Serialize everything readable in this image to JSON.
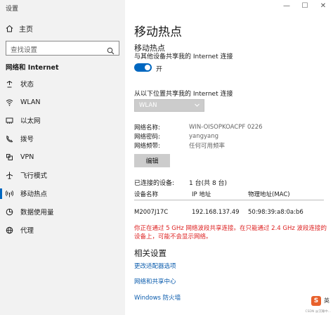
{
  "window": {
    "title": "设置",
    "controls": [
      "—",
      "☐",
      "✕"
    ]
  },
  "sidebar": {
    "home_label": "主页",
    "search_placeholder": "查找设置",
    "section_title": "网络和 Internet",
    "items": [
      {
        "label": "状态",
        "icon": "status-icon"
      },
      {
        "label": "WLAN",
        "icon": "wifi-icon"
      },
      {
        "label": "以太网",
        "icon": "ethernet-icon"
      },
      {
        "label": "拨号",
        "icon": "dialup-icon"
      },
      {
        "label": "VPN",
        "icon": "vpn-icon"
      },
      {
        "label": "飞行模式",
        "icon": "airplane-icon"
      },
      {
        "label": "移动热点",
        "icon": "hotspot-icon",
        "active": true
      },
      {
        "label": "数据使用量",
        "icon": "data-usage-icon"
      },
      {
        "label": "代理",
        "icon": "globe-icon"
      }
    ]
  },
  "main": {
    "title": "移动热点",
    "hotspot": {
      "title": "移动热点",
      "description": "与其他设备共享我的 Internet 连接",
      "toggle_state": "开",
      "toggle_on": true
    },
    "share_from": {
      "label": "从以下位置共享我的 Internet 连接",
      "selected": "WLAN"
    },
    "network_info": [
      {
        "key": "网络名称:",
        "value": "WIN-OISOPKOACPF 0226"
      },
      {
        "key": "网络密码:",
        "value": "yangyang"
      },
      {
        "key": "网络频带:",
        "value": "任何可用频率"
      }
    ],
    "edit_button": "编辑",
    "connected": {
      "label": "已连接的设备:",
      "value": "1 台(共 8 台)"
    },
    "device_table": {
      "headers": [
        "设备名称",
        "IP 地址",
        "物理地址(MAC)"
      ],
      "rows": [
        [
          "M2007J17C",
          "192.168.137.49",
          "50:98:39:a8:0a:b6"
        ]
      ]
    },
    "warning": "你正在通过 5 GHz 网络波段共享连接。在只能通过 2.4 GHz 波段连接的设备上，可能不会显示网络。",
    "related": {
      "title": "相关设置",
      "links": [
        "更改适配器选项",
        "网络和共享中心",
        "Windows 防火墙"
      ]
    }
  },
  "watermark": {
    "logo": "S",
    "ime": "英",
    "text": "CSDN @沉睡中..."
  },
  "colors": {
    "accent": "#0067c0",
    "sidebar_bg": "#f2f2f2",
    "warning": "#dd2222",
    "link": "#0b5cad"
  }
}
